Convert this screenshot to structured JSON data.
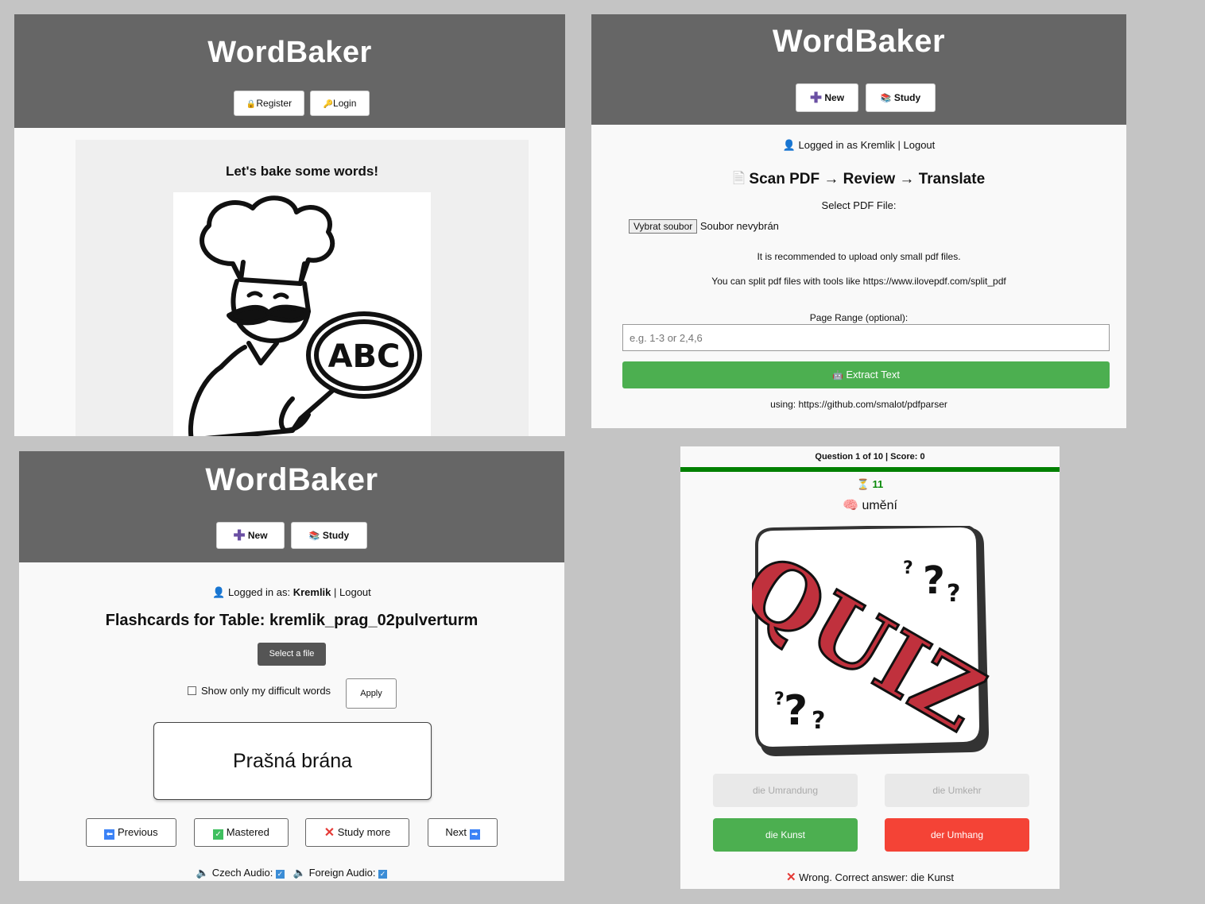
{
  "app": {
    "title": "WordBaker"
  },
  "panel1": {
    "register_label": "Register",
    "login_label": "Login",
    "tagline": "Let's bake some words!",
    "image_text": "ABC"
  },
  "panel2": {
    "new_label": "New",
    "study_label": "Study",
    "logged_in": "Logged in as Kremlik | Logout",
    "heading": "Scan PDF → Review → Translate",
    "select_label": "Select PDF File:",
    "file_button": "Vybrat soubor",
    "file_status": "Soubor nevybrán",
    "note1": "It is recommended to upload only small pdf files.",
    "note2": "You can split pdf files with tools like https://www.ilovepdf.com/split_pdf",
    "range_label": "Page Range (optional):",
    "range_placeholder": "e.g. 1-3 or 2,4,6",
    "extract_label": "Extract Text",
    "using": "using: https://github.com/smalot/pdfparser"
  },
  "panel3": {
    "new_label": "New",
    "study_label": "Study",
    "logged_prefix": "Logged in as: ",
    "user": "Kremlik",
    "logout": " | Logout",
    "heading": "Flashcards for Table: kremlik_prag_02pulverturm",
    "select_file": "Select a file",
    "difficult_label": "Show only my difficult words",
    "apply_label": "Apply",
    "card_word": "Prašná brána",
    "prev_label": "Previous",
    "mastered_label": "Mastered",
    "study_more_label": "Study more",
    "next_label": "Next",
    "czech_audio": "Czech Audio:",
    "foreign_audio": "Foreign Audio:"
  },
  "panel4": {
    "progress_prefix": "Question ",
    "question_num": "1",
    "of_total": " of 10 | Score: 0",
    "timer": "11",
    "word": "umění",
    "image_text": "QUIZ",
    "answers": [
      "die Umrandung",
      "die Umkehr",
      "die Kunst",
      "der Umhang"
    ],
    "feedback": "Wrong. Correct answer: die Kunst"
  },
  "colors": {
    "header": "#666666",
    "green": "#4caf50",
    "red": "#f44336",
    "progress": "#008000"
  }
}
